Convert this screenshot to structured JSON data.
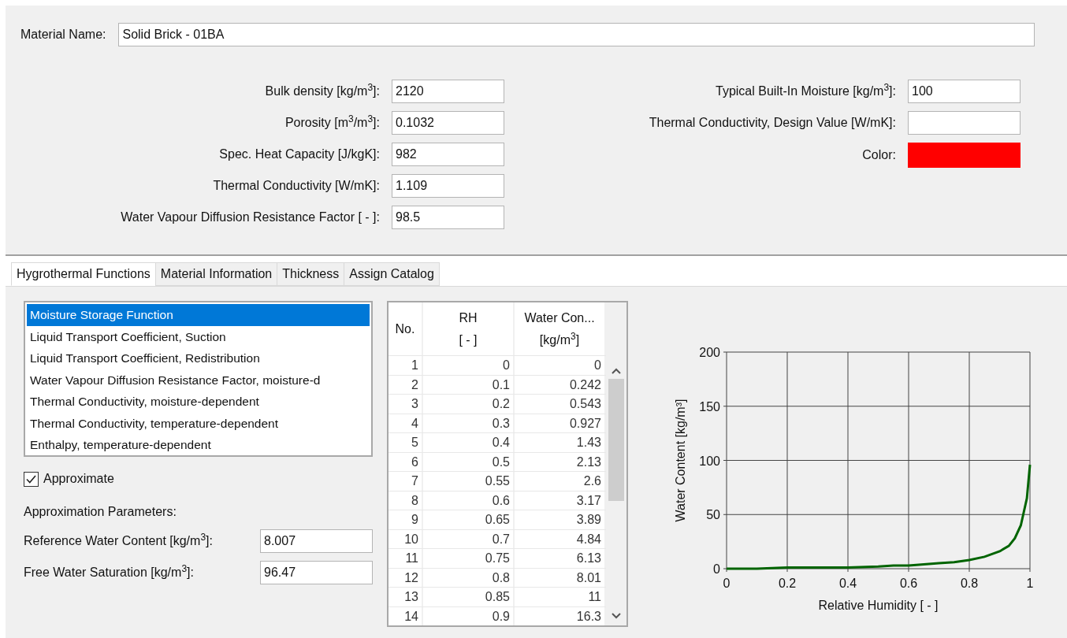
{
  "material_name": {
    "label": "Material Name:",
    "value": "Solid Brick - 01BA"
  },
  "left_fields": [
    {
      "label": "Bulk density [kg/m$^{3}$]:",
      "value": "2120"
    },
    {
      "label": "Porosity [m$^{3}$/m$^{3}$]:",
      "value": "0.1032"
    },
    {
      "label": "Spec. Heat Capacity [J/kgK]:",
      "value": "982"
    },
    {
      "label": "Thermal Conductivity [W/mK]:",
      "value": "1.109"
    },
    {
      "label": "Water Vapour Diffusion Resistance Factor [ - ]:",
      "value": "98.5"
    }
  ],
  "right_fields": [
    {
      "kind": "input",
      "label": "Typical Built-In Moisture [kg/m$^{3}$]:",
      "value": "100"
    },
    {
      "kind": "input",
      "label": "Thermal Conductivity, Design Value [W/mK]:"
    },
    {
      "kind": "color",
      "label": "Color:",
      "color": "#ff0000"
    }
  ],
  "tabs": [
    {
      "label": "Hygrothermal Functions",
      "selected": true
    },
    {
      "label": "Material Information",
      "selected": false
    },
    {
      "label": "Thickness",
      "selected": false
    },
    {
      "label": "Assign Catalog",
      "selected": false
    }
  ],
  "functions": [
    {
      "label": "Moisture Storage Function",
      "selected": true
    },
    {
      "label": "Liquid Transport Coefficient, Suction",
      "selected": false
    },
    {
      "label": "Liquid Transport Coefficient, Redistribution",
      "selected": false
    },
    {
      "label": "Water Vapour Diffusion Resistance Factor, moisture-d",
      "selected": false
    },
    {
      "label": "Thermal Conductivity, moisture-dependent",
      "selected": false
    },
    {
      "label": "Thermal Conductivity, temperature-dependent",
      "selected": false
    },
    {
      "label": "Enthalpy, temperature-dependent",
      "selected": false
    }
  ],
  "approximate": {
    "label": "Approximate",
    "checked": true
  },
  "approximation_parameters": {
    "title": "Approximation Parameters:",
    "fields": [
      {
        "label": "Reference Water Content [kg/m$^{3}$]:",
        "value": "8.007"
      },
      {
        "label": "Free Water Saturation [kg/m$^{3}$]:",
        "value": "96.47"
      }
    ]
  },
  "table": {
    "columns": [
      {
        "line1": "No."
      },
      {
        "line1": "RH",
        "line2": "[ - ]"
      },
      {
        "line1": "Water Con...",
        "line2": "[kg/m$^{3}$]"
      }
    ],
    "rows": [
      [
        "1",
        "0",
        "0"
      ],
      [
        "2",
        "0.1",
        "0.242"
      ],
      [
        "3",
        "0.2",
        "0.543"
      ],
      [
        "4",
        "0.3",
        "0.927"
      ],
      [
        "5",
        "0.4",
        "1.43"
      ],
      [
        "6",
        "0.5",
        "2.13"
      ],
      [
        "7",
        "0.55",
        "2.6"
      ],
      [
        "8",
        "0.6",
        "3.17"
      ],
      [
        "9",
        "0.65",
        "3.89"
      ],
      [
        "10",
        "0.7",
        "4.84"
      ],
      [
        "11",
        "0.75",
        "6.13"
      ],
      [
        "12",
        "0.8",
        "8.01"
      ],
      [
        "13",
        "0.85",
        "11"
      ],
      [
        "14",
        "0.9",
        "16.3"
      ]
    ]
  },
  "chart_data": {
    "type": "line",
    "xlabel": "Relative Humidity [ - ]",
    "ylabel": "Water Content [kg/m³]",
    "x": [
      0,
      0.1,
      0.2,
      0.3,
      0.4,
      0.5,
      0.55,
      0.6,
      0.65,
      0.7,
      0.75,
      0.8,
      0.85,
      0.9,
      0.93,
      0.95,
      0.97,
      0.99,
      1
    ],
    "series": [
      {
        "color": "#006400",
        "values": [
          0,
          0,
          1,
          1,
          1,
          2,
          3,
          3,
          4,
          5,
          6,
          8,
          11,
          16,
          21,
          28,
          40,
          65,
          96
        ]
      }
    ],
    "grid": true,
    "xlim": [
      0,
      1
    ],
    "ylim": [
      0,
      200
    ],
    "xticks": [
      0,
      0.2,
      0.4,
      0.6,
      0.8,
      1
    ],
    "yticks": [
      0,
      50,
      100,
      150,
      200
    ]
  }
}
